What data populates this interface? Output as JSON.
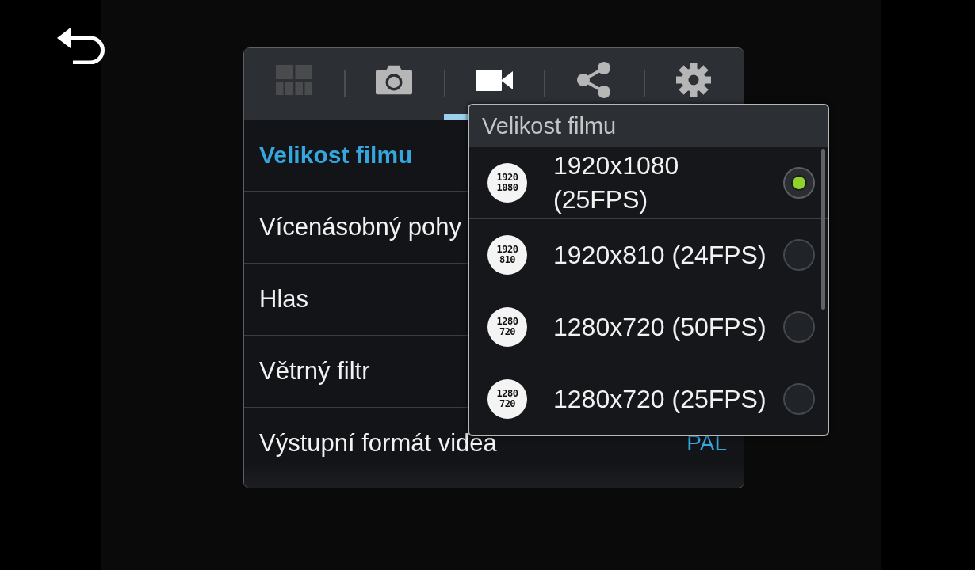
{
  "tabs": [
    {
      "selected": false,
      "disabled": true
    },
    {
      "selected": false,
      "disabled": false
    },
    {
      "selected": true,
      "disabled": false
    },
    {
      "selected": false,
      "disabled": false
    },
    {
      "selected": false,
      "disabled": false
    }
  ],
  "settings": [
    {
      "label": "Velikost filmu",
      "selected": true
    },
    {
      "label": "Vícenásobný pohy",
      "selected": false
    },
    {
      "label": "Hlas",
      "selected": false
    },
    {
      "label": "Větrný filtr",
      "selected": false
    },
    {
      "label": "Výstupní formát videa",
      "selected": false,
      "value": "PAL"
    }
  ],
  "popup": {
    "title": "Velikost filmu",
    "options": [
      {
        "badge": [
          "1920",
          "1080"
        ],
        "label": "1920x1080 (25FPS)",
        "selected": true
      },
      {
        "badge": [
          "1920",
          "810"
        ],
        "label": "1920x810 (24FPS)",
        "selected": false
      },
      {
        "badge": [
          "1280",
          "720"
        ],
        "label": "1280x720 (50FPS)",
        "selected": false
      },
      {
        "badge": [
          "1280",
          "720"
        ],
        "label": "1280x720 (25FPS)",
        "selected": false
      }
    ]
  }
}
